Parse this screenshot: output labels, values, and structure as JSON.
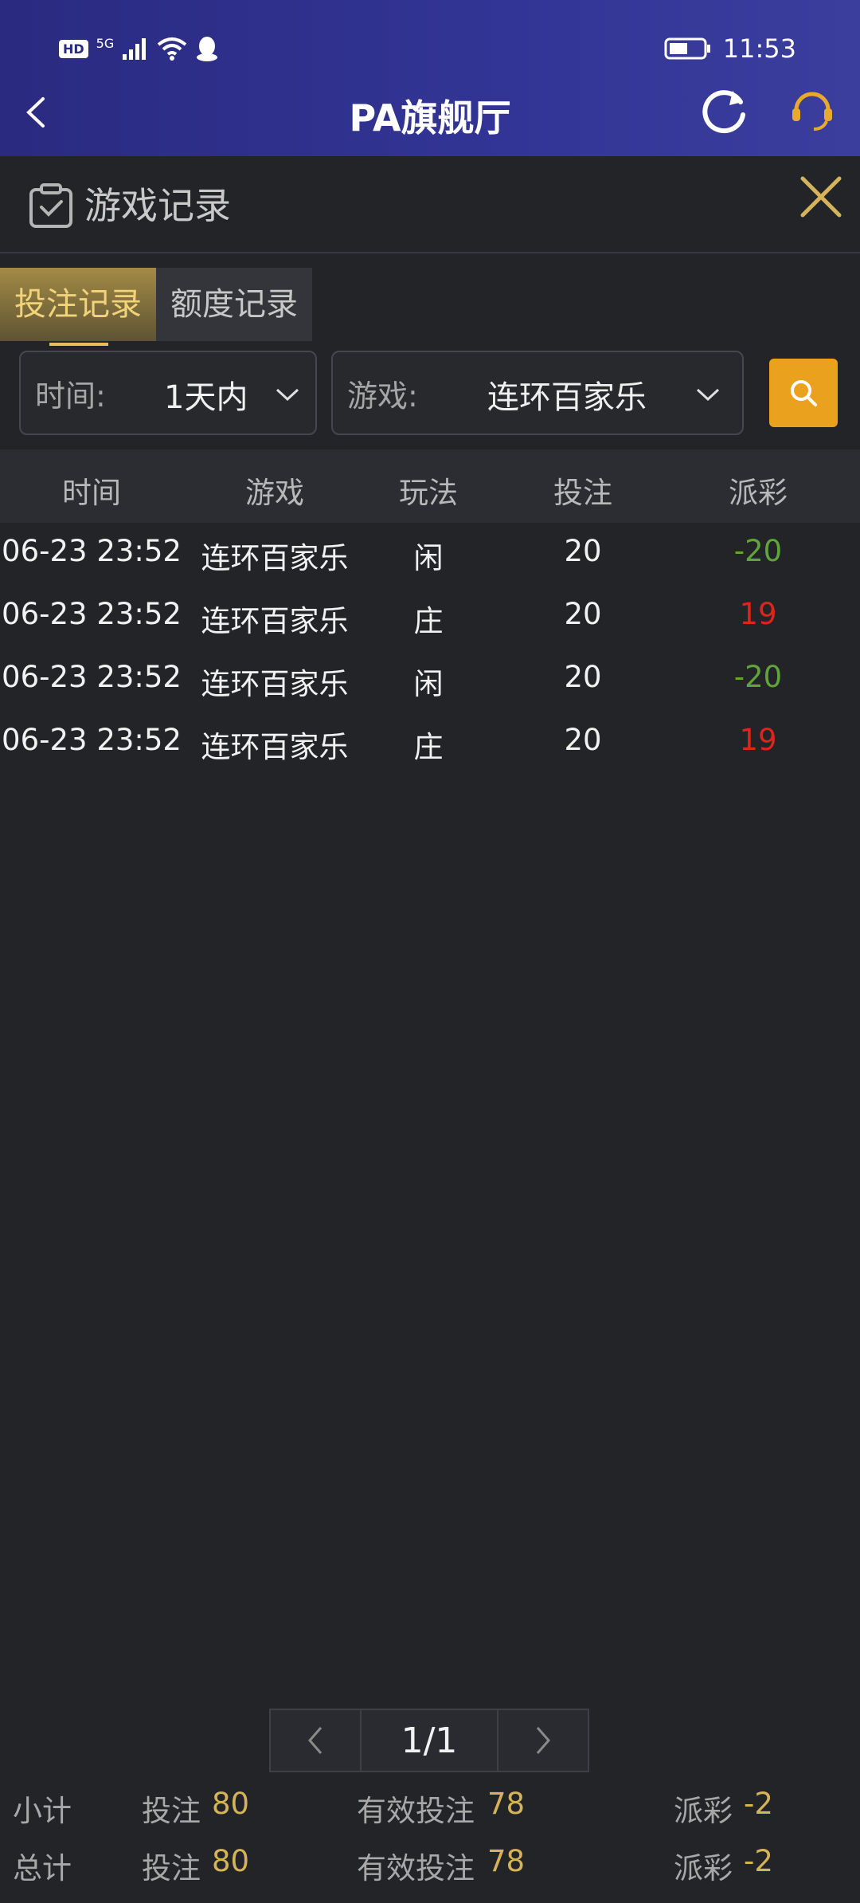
{
  "status_bar": {
    "hd": "HD",
    "network": "5G",
    "time": "11:53"
  },
  "header": {
    "title": "PA旗舰厅"
  },
  "section": {
    "title": "游戏记录"
  },
  "tabs": [
    {
      "label": "投注记录"
    },
    {
      "label": "额度记录"
    }
  ],
  "filters": {
    "time_label": "时间:",
    "time_value": "1天内",
    "game_label": "游戏:",
    "game_value": "连环百家乐"
  },
  "table": {
    "headers": [
      "时间",
      "游戏",
      "玩法",
      "投注",
      "派彩"
    ],
    "rows": [
      [
        "06-23 23:52",
        "连环百家乐",
        "闲",
        "20",
        "-20"
      ],
      [
        "06-23 23:52",
        "连环百家乐",
        "庄",
        "20",
        "19"
      ],
      [
        "06-23 23:52",
        "连环百家乐",
        "闲",
        "20",
        "-20"
      ],
      [
        "06-23 23:52",
        "连环百家乐",
        "庄",
        "20",
        "19"
      ]
    ]
  },
  "pager": {
    "label": "1/1"
  },
  "subtotal": {
    "label": "小计",
    "bet_label": "投注",
    "bet": "80",
    "valid_label": "有效投注",
    "valid": "78",
    "payout_label": "派彩",
    "payout": "-2"
  },
  "total": {
    "label": "总计",
    "bet_label": "投注",
    "bet": "80",
    "valid_label": "有效投注",
    "valid": "78",
    "payout_label": "派彩",
    "payout": "-2"
  },
  "colors": {
    "accent": "#eaa11e",
    "gold_text": "#d6b35a",
    "loss": "#5fa53a",
    "win": "#e0231d",
    "header_bg": "#333596"
  }
}
